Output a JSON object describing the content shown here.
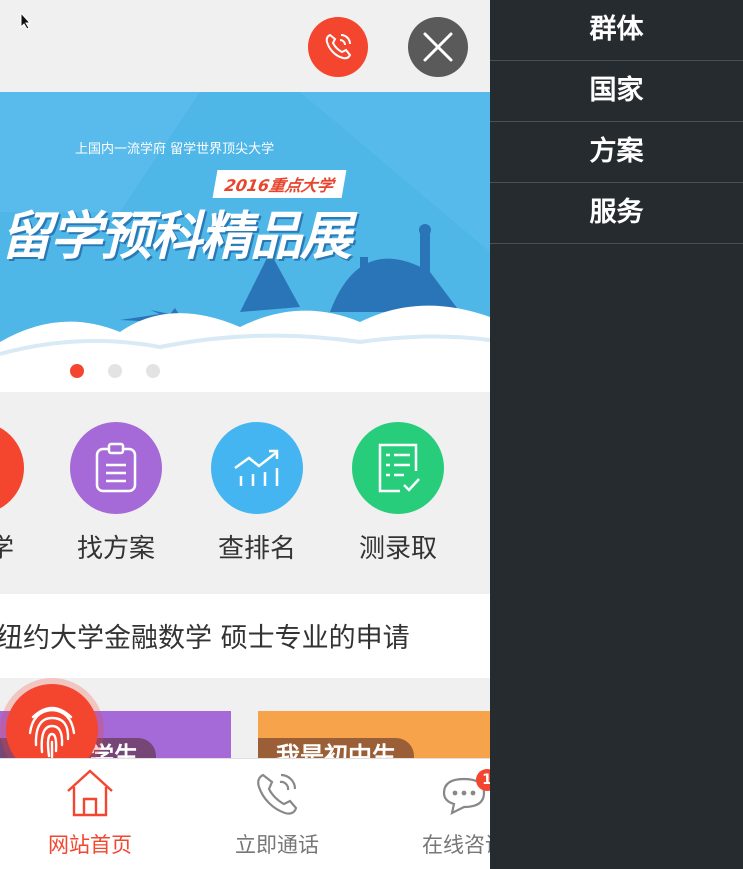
{
  "topbar": {
    "phone_icon": "phone-icon",
    "close_icon": "close-icon"
  },
  "banner": {
    "subtitle": "上国内一流学府 留学世界顶尖大学",
    "year_tag": "2016重点大学",
    "headline": "留学预科精品展",
    "slides": 3,
    "active_slide": 1
  },
  "quick_links": [
    {
      "label": "学",
      "color": "#f4452f",
      "icon": "cap-icon"
    },
    {
      "label": "找方案",
      "color": "#a56ad8",
      "icon": "clipboard-icon"
    },
    {
      "label": "查排名",
      "color": "#45b5f1",
      "icon": "chart-icon"
    },
    {
      "label": "测录取",
      "color": "#27cd7a",
      "icon": "checklist-icon"
    }
  ],
  "news": {
    "text": "纽约大学金融数学 硕士专业的申请"
  },
  "cards": [
    {
      "label": "我是大学生",
      "color": "#a56ad8"
    },
    {
      "label": "我是初中生",
      "color": "#f7a34b"
    }
  ],
  "bottom_nav": [
    {
      "label": "网站首页",
      "icon": "home-icon",
      "active": true
    },
    {
      "label": "立即通话",
      "icon": "phone-icon",
      "active": false
    },
    {
      "label": "在线咨询",
      "icon": "chat-icon",
      "active": false,
      "badge": "1"
    }
  ],
  "sidebar": {
    "items": [
      {
        "label": "群体"
      },
      {
        "label": "国家"
      },
      {
        "label": "方案"
      },
      {
        "label": "服务"
      }
    ]
  },
  "colors": {
    "accent": "#f4452f",
    "sidebar_bg": "#252b2f",
    "banner_bg": "#4fb6e8"
  }
}
